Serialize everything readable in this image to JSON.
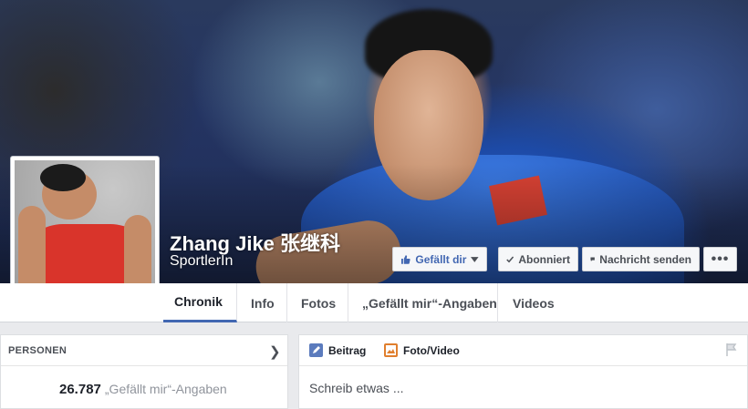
{
  "cover": {
    "page_name": "Zhang Jike 张继科",
    "category": "SportlerIn",
    "buttons": {
      "like": "Gefällt dir",
      "follow": "Abonniert",
      "message": "Nachricht senden",
      "more": "•••"
    }
  },
  "tabs": [
    {
      "label": "Chronik",
      "active": true
    },
    {
      "label": "Info",
      "active": false
    },
    {
      "label": "Fotos",
      "active": false
    },
    {
      "label": "„Gefällt mir“-Angaben",
      "active": false
    },
    {
      "label": "Videos",
      "active": false
    }
  ],
  "people_card": {
    "header": "PERSONEN",
    "likes_count": "26.787",
    "likes_label": "„Gefällt mir“-Angaben"
  },
  "composer": {
    "tab_post": "Beitrag",
    "tab_photo": "Foto/Video",
    "placeholder": "Schreib etwas ..."
  },
  "colors": {
    "accent": "#4267b2",
    "background": "#e9eaed",
    "photo_icon": "#e07f2e"
  }
}
